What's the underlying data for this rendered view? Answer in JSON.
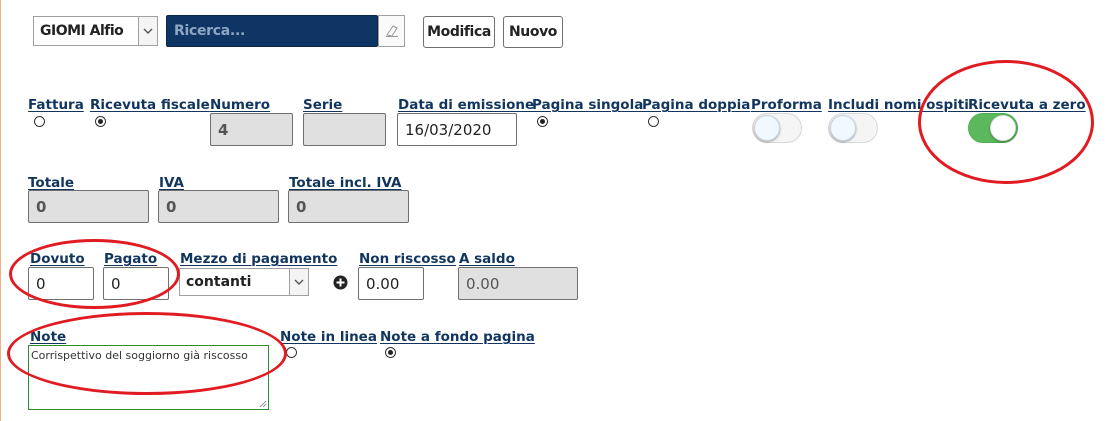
{
  "header": {
    "guest_select": "GIOMI Alfio",
    "search_placeholder": "Ricerca...",
    "edit_label": "Modifica",
    "new_label": "Nuovo"
  },
  "doc_type": {
    "fattura_label": "Fattura",
    "ricevuta_label": "Ricevuta fiscale",
    "selected": "Ricevuta fiscale"
  },
  "numero": {
    "label": "Numero",
    "value": "4"
  },
  "serie": {
    "label": "Serie",
    "value": ""
  },
  "data_emissione": {
    "label": "Data di emissione",
    "value": "16/03/2020"
  },
  "pagina": {
    "singola_label": "Pagina singola",
    "doppia_label": "Pagina doppia",
    "selected": "Pagina singola"
  },
  "toggles": {
    "proforma_label": "Proforma",
    "proforma_on": false,
    "includi_label": "Includi nomi ospiti",
    "includi_on": false,
    "ricevuta_zero_label": "Ricevuta a zero",
    "ricevuta_zero_on": true
  },
  "totals": {
    "totale_label": "Totale",
    "totale_value": "0",
    "iva_label": "IVA",
    "iva_value": "0",
    "incl_label": "Totale incl. IVA",
    "incl_value": "0"
  },
  "payment": {
    "dovuto_label": "Dovuto",
    "dovuto_value": "0",
    "pagato_label": "Pagato",
    "pagato_value": "0",
    "mezzo_label": "Mezzo di pagamento",
    "mezzo_value": "contanti",
    "non_riscosso_label": "Non riscosso",
    "non_riscosso_value": "0.00",
    "saldo_label": "A saldo",
    "saldo_value": "0.00"
  },
  "notes": {
    "note_label": "Note",
    "note_value": "Corrispettivo del soggiorno già riscosso",
    "in_linea_label": "Note in linea",
    "fondo_label": "Note a fondo pagina",
    "selected": "Note a fondo pagina"
  },
  "colors": {
    "label": "#12355e",
    "search_bg": "#0f3564",
    "toggle_on": "#5cb85c",
    "annotation": "#e01b22"
  },
  "icons": [
    "eraser-icon",
    "chevron-down-icon",
    "plus-circle-icon"
  ]
}
